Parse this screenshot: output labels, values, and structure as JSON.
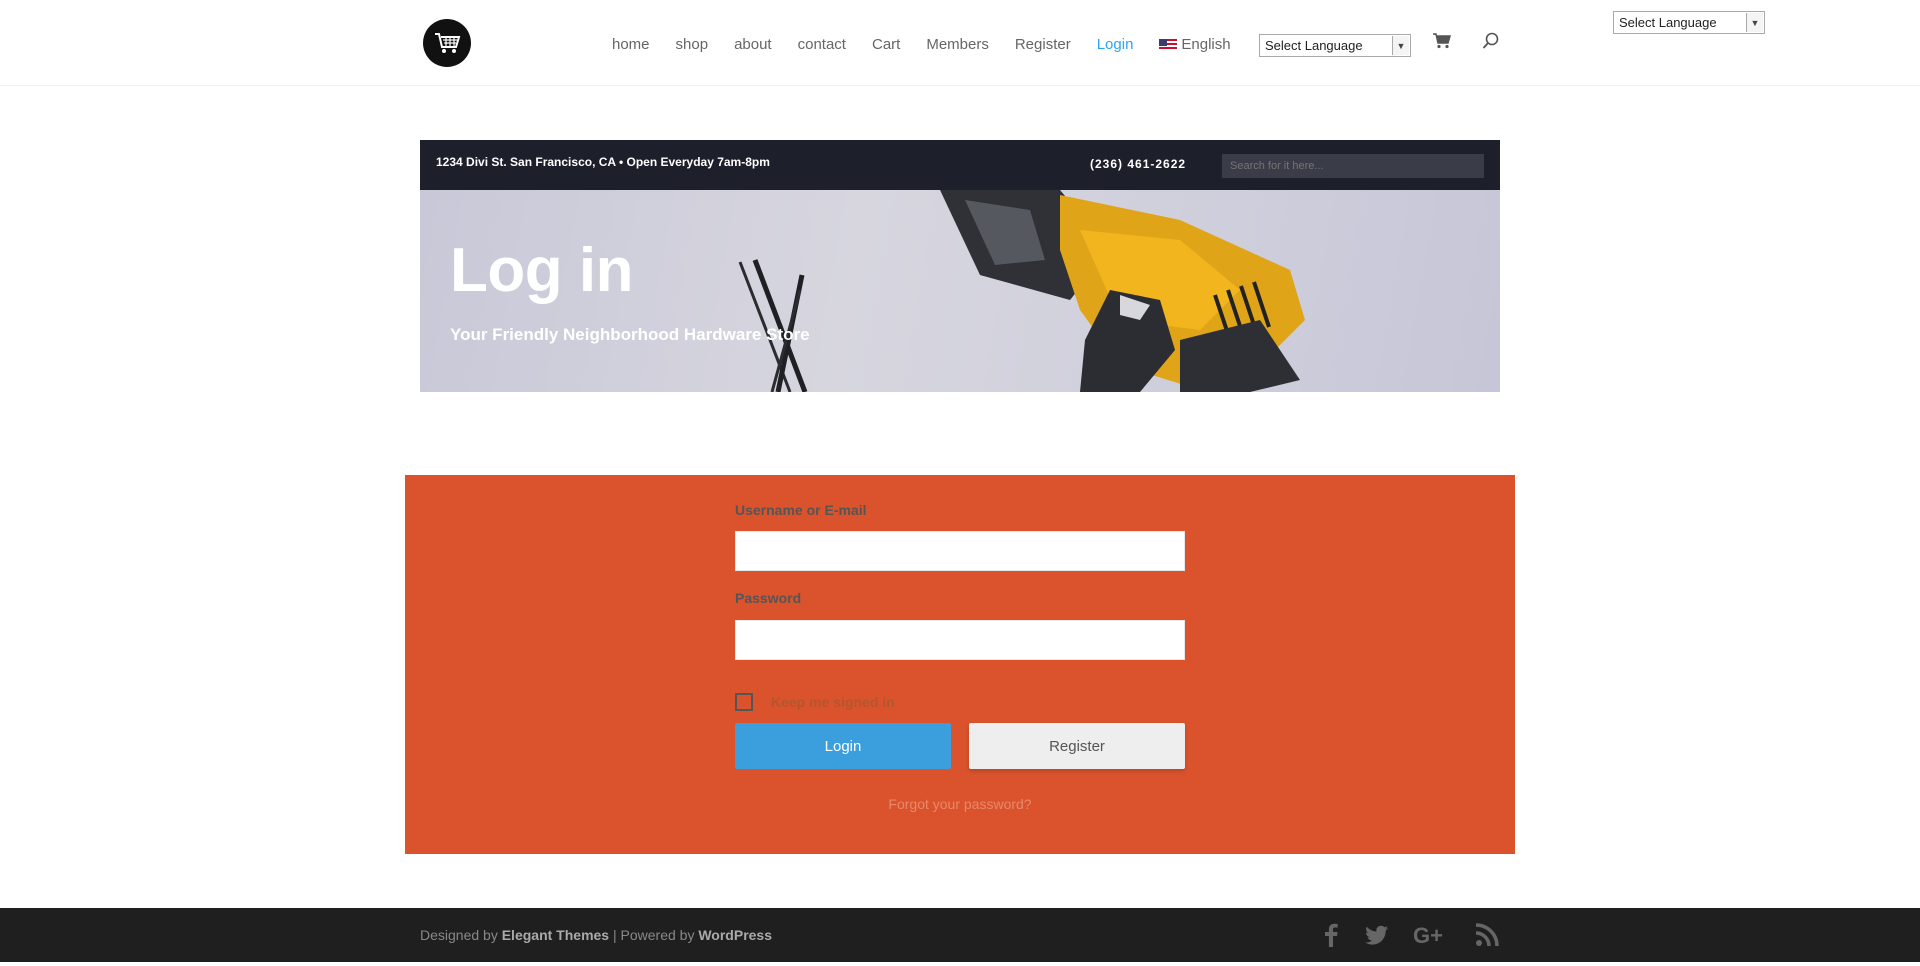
{
  "header": {
    "nav": [
      {
        "label": "home",
        "active": false
      },
      {
        "label": "shop",
        "active": false
      },
      {
        "label": "about",
        "active": false
      },
      {
        "label": "contact",
        "active": false
      },
      {
        "label": "Cart",
        "active": false
      },
      {
        "label": "Members",
        "active": false
      },
      {
        "label": "Register",
        "active": false
      },
      {
        "label": "Login",
        "active": true
      }
    ],
    "language_label": "English",
    "language_select": "Select Language",
    "top_language_select": "Select Language",
    "active_color": "#2ea3f2"
  },
  "hero": {
    "address": "1234 Divi St. San Francisco, CA • Open Everyday 7am-8pm",
    "phone": "(236) 461-2622",
    "search_placeholder": "Search for it here...",
    "title": "Log in",
    "subtitle": "Your Friendly Neighborhood Hardware Store"
  },
  "login": {
    "username_label": "Username or E-mail",
    "username_value": "",
    "password_label": "Password",
    "password_value": "",
    "remember_label": "Keep me signed in",
    "remember_checked": false,
    "login_button": "Login",
    "register_button": "Register",
    "forgot_link": "Forgot your password?",
    "section_color": "#da532c",
    "login_button_color": "#3a9fdc"
  },
  "footer": {
    "designed_by_prefix": "Designed by ",
    "designed_by_name": "Elegant Themes",
    "separator": " | Powered by ",
    "powered_by_name": "WordPress",
    "social_icons": [
      "facebook-icon",
      "twitter-icon",
      "google-plus-icon",
      "rss-icon"
    ]
  }
}
